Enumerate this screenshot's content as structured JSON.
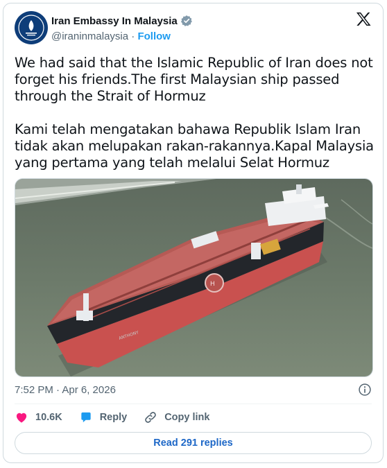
{
  "author": {
    "name": "Iran Embassy In Malaysia",
    "handle": "@iraninmalaysia",
    "separator": "·",
    "follow_label": "Follow",
    "verified_icon": "verified-badge-icon",
    "avatar_icon": "embassy-emblem-icon"
  },
  "tweet": {
    "text": "We had said that the Islamic Republic of Iran does not forget his friends.The first Malaysian ship passed through the Strait of Hormuz\n\nKami telah mengatakan bahawa Republik Islam Iran tidak akan melupakan rakan-rakannya.Kapal Malaysia yang pertama yang telah melalui Selat Hormuz",
    "media_icon": "oil-tanker-photo",
    "timestamp": "7:52 PM · Apr 6, 2026"
  },
  "actions": {
    "like_count": "10.6K",
    "reply_label": "Reply",
    "copy_link_label": "Copy link",
    "read_replies_label": "Read 291 replies"
  },
  "colors": {
    "accent": "#1d9bf0",
    "like": "#f91880",
    "muted": "#536471",
    "hull": "#c9514f"
  }
}
